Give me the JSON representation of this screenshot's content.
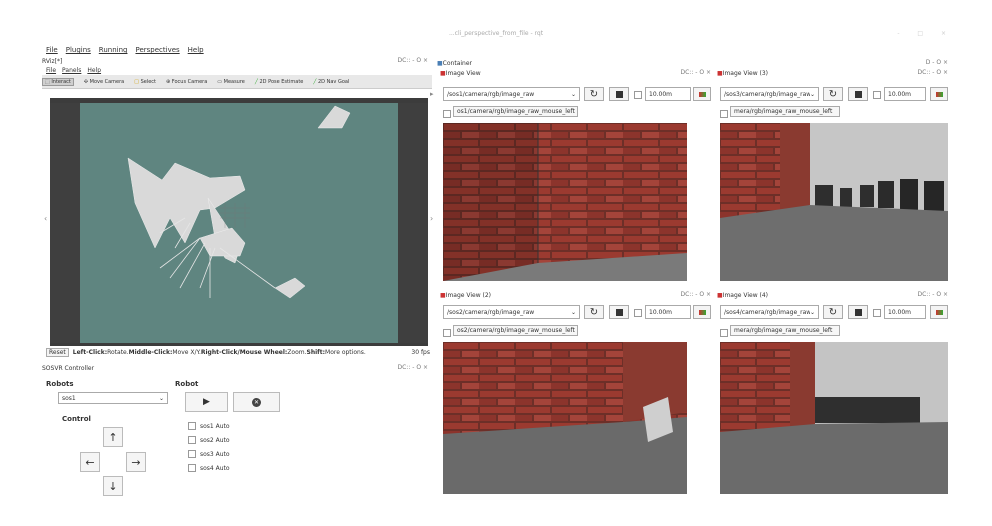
{
  "window": {
    "title": "...cli_perspective_from_file - rqt",
    "buttons": "- □ ×"
  },
  "menu": [
    "File",
    "Plugins",
    "Running",
    "Perspectives",
    "Help"
  ],
  "rviz": {
    "title": "RViz[*]",
    "dock_controls": "DC:: - O ×",
    "menu": [
      "File",
      "Panels",
      "Help"
    ],
    "toolbar": [
      "Interact",
      "Move Camera",
      "Select",
      "Focus Camera",
      "Measure",
      "2D Pose Estimate",
      "2D Nav Goal"
    ],
    "status": {
      "reset": "Reset",
      "hint_bold1": "Left-Click:",
      "hint1": " Rotate. ",
      "hint_bold2": "Middle-Click:",
      "hint2": " Move X/Y. ",
      "hint_bold3": "Right-Click/Mouse Wheel:",
      "hint3": " Zoom. ",
      "hint_bold4": "Shift:",
      "hint4": " More options.",
      "fps": "30 fps"
    }
  },
  "controller": {
    "title": "SOSVR Controller",
    "dock_controls": "DC:: - O ×",
    "robots_label": "Robots",
    "robot_selected": "sos1",
    "robot_label": "Robot",
    "control_label": "Control",
    "auto_checks": [
      "sos1 Auto",
      "sos2 Auto",
      "sos3 Auto",
      "sos4 Auto"
    ]
  },
  "container": {
    "title": "Container",
    "controls": "D - O ×"
  },
  "image_views": [
    {
      "title": "Image View",
      "topic": "/sos1/camera/rgb/image_raw",
      "zoom": "10.00m",
      "mouse_topic": "os1/camera/rgb/image_raw_mouse_left",
      "controls": "DC:: - O ×"
    },
    {
      "title": "Image View (3)",
      "topic": "/sos3/camera/rgb/image_raw",
      "zoom": "10.00m",
      "mouse_topic": "mera/rgb/image_raw_mouse_left",
      "controls": "DC:: - O ×"
    },
    {
      "title": "Image View (2)",
      "topic": "/sos2/camera/rgb/image_raw",
      "zoom": "10.00m",
      "mouse_topic": "os2/camera/rgb/image_raw_mouse_left",
      "controls": "DC:: - O ×"
    },
    {
      "title": "Image View (4)",
      "topic": "/sos4/camera/rgb/image_raw",
      "zoom": "10.00m",
      "mouse_topic": "mera/rgb/image_raw_mouse_left",
      "controls": "DC:: - O ×"
    }
  ]
}
